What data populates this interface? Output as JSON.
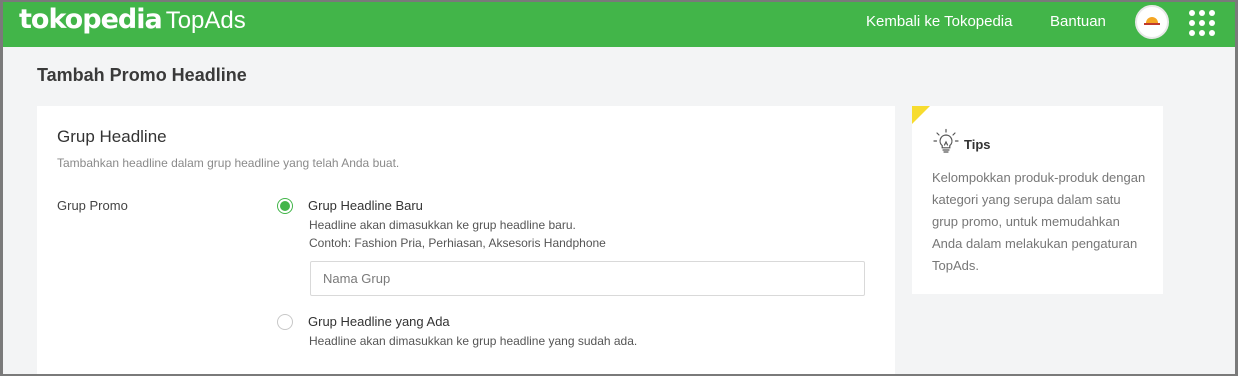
{
  "header": {
    "logo_brand": "tokopedia",
    "logo_product": "TopAds",
    "nav_back": "Kembali ke Tokopedia",
    "nav_help": "Bantuan",
    "accent_color": "#42b549"
  },
  "page": {
    "title": "Tambah Promo Headline"
  },
  "form": {
    "title": "Grup Headline",
    "subtitle": "Tambahkan headline dalam grup headline yang telah Anda buat.",
    "field_label": "Grup Promo",
    "options": [
      {
        "label": "Grup Headline Baru",
        "desc1": "Headline akan dimasukkan ke grup headline baru.",
        "desc2": "Contoh: Fashion Pria, Perhiasan, Aksesoris Handphone",
        "selected": true
      },
      {
        "label": "Grup Headline yang Ada",
        "desc1": "Headline akan dimasukkan ke grup headline yang sudah ada.",
        "selected": false
      }
    ],
    "group_name": {
      "placeholder": "Nama Grup",
      "value": ""
    }
  },
  "tips": {
    "title": "Tips",
    "text": "Kelompokkan produk-produk dengan kategori yang serupa dalam satu grup promo, untuk memudahkan Anda dalam melakukan pengaturan TopAds.",
    "icon": "lightbulb-icon",
    "corner_color": "#f7dc2f"
  }
}
